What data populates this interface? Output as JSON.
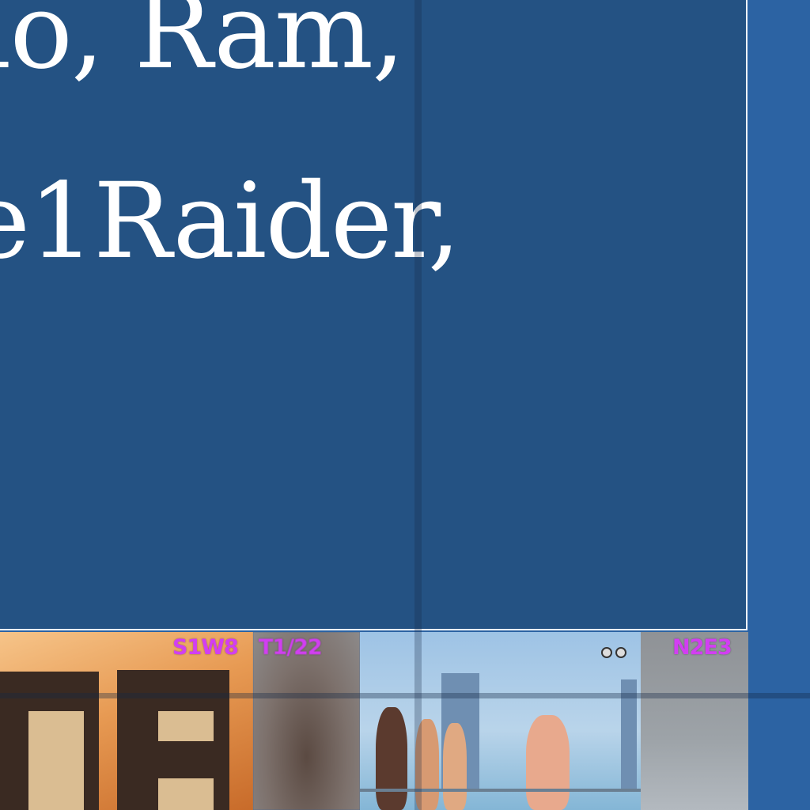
{
  "greeting": {
    "line1": "llo,  Ram,",
    "line2": "e1Raider,"
  },
  "thumbnails": [
    {
      "code": "S1W8",
      "scene": "sunset building"
    },
    {
      "code": "T1/22",
      "scene": "blurred figure"
    },
    {
      "code": "",
      "scene": "boat party city skyline"
    },
    {
      "code": "N2E3",
      "scene": "blurred grey"
    }
  ],
  "colors": {
    "background": "#2c63a3",
    "panel": "#245283",
    "code_label": "#d23ef2"
  }
}
